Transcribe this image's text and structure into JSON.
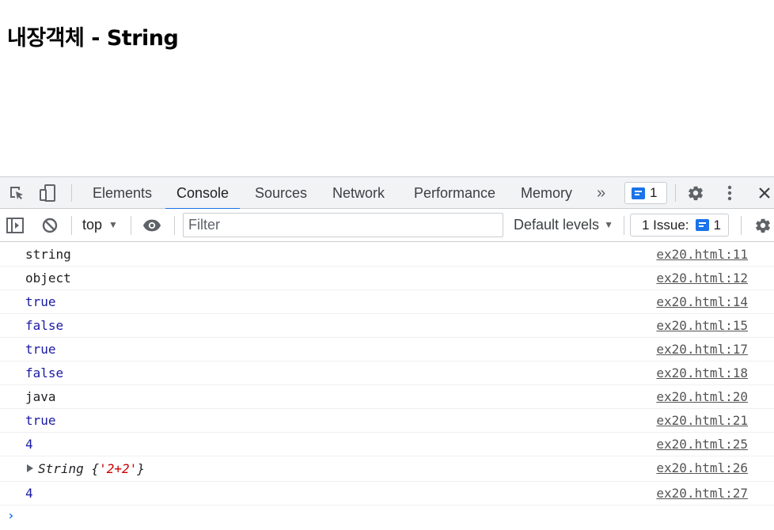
{
  "page": {
    "heading": "내장객체 - String"
  },
  "devtools": {
    "tabs": [
      {
        "label": "Elements"
      },
      {
        "label": "Console"
      },
      {
        "label": "Sources"
      },
      {
        "label": "Network"
      },
      {
        "label": "Performance"
      },
      {
        "label": "Memory"
      }
    ],
    "active_tab": "Console",
    "more_tabs_glyph": "»",
    "message_count": "1",
    "toolbar": {
      "context": "top",
      "filter_placeholder": "Filter",
      "levels": "Default levels",
      "issues_label": "1 Issue:",
      "issues_count": "1"
    },
    "accent_color": "#1a73e8"
  },
  "console": {
    "rows": [
      {
        "text": "string",
        "source": "ex20.html:11",
        "kind": "string"
      },
      {
        "text": "object",
        "source": "ex20.html:12",
        "kind": "string"
      },
      {
        "text": "true",
        "source": "ex20.html:14",
        "kind": "literal"
      },
      {
        "text": "false",
        "source": "ex20.html:15",
        "kind": "literal"
      },
      {
        "text": "true",
        "source": "ex20.html:17",
        "kind": "literal"
      },
      {
        "text": "false",
        "source": "ex20.html:18",
        "kind": "literal"
      },
      {
        "text": "java",
        "source": "ex20.html:20",
        "kind": "string"
      },
      {
        "text": "true",
        "source": "ex20.html:21",
        "kind": "literal"
      },
      {
        "text": "4",
        "source": "ex20.html:25",
        "kind": "literal"
      }
    ],
    "object_row": {
      "prefix": "String {",
      "value": "'2+2'",
      "suffix": "}",
      "source": "ex20.html:26"
    },
    "last_row": {
      "text": "4",
      "source": "ex20.html:27",
      "kind": "literal"
    },
    "prompt_glyph": "›"
  }
}
